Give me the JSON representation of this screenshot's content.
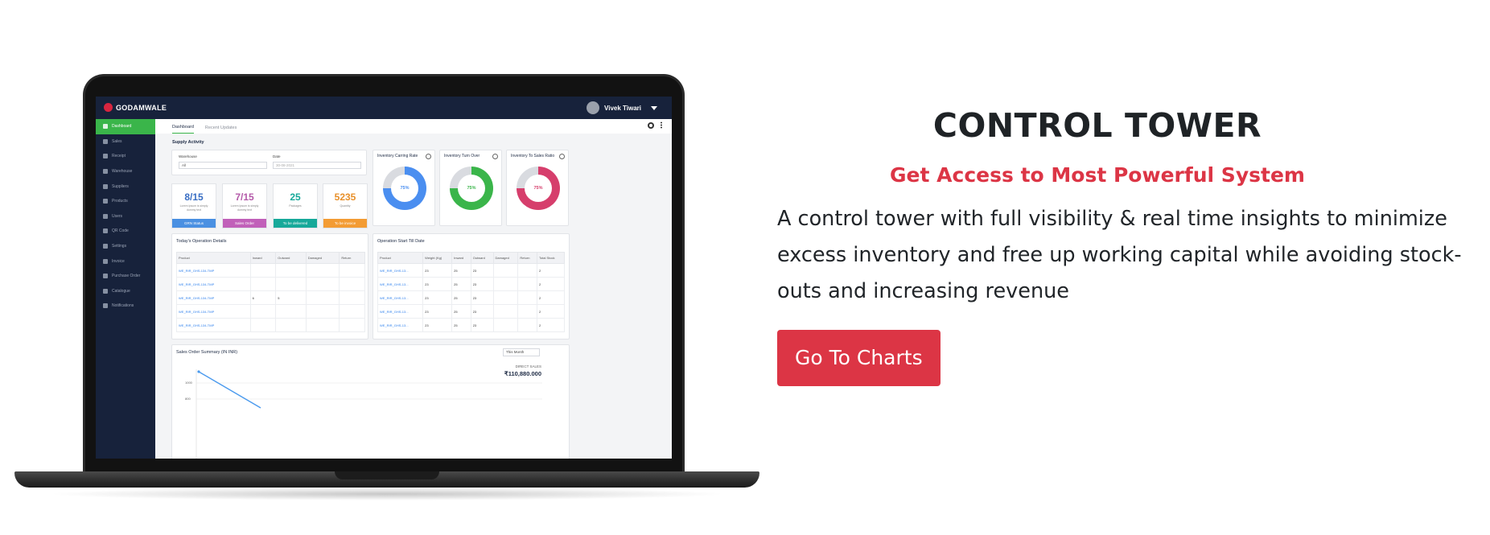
{
  "dashboard": {
    "brand": "GODAMWALE",
    "user_name": "Vivek Tiwari",
    "sidebar_items": [
      "Dashboard",
      "Sales",
      "Receipt",
      "Warehouse",
      "Suppliers",
      "Products",
      "Users",
      "QR Code",
      "Settings",
      "Invoice",
      "Purchase Order",
      "Catalogue",
      "Notifications"
    ],
    "tabs": [
      "Dashboard",
      "Recent Updates"
    ],
    "section_title": "Supply Activity",
    "filters": {
      "warehouse_label": "Warehouse",
      "warehouse_value": "All",
      "date_label": "Date",
      "date_value": "30-08-2021"
    },
    "kpis": [
      {
        "value": "8/15",
        "sub": "Lorem Ipsum is simply dummy text",
        "foot": "GRN Status",
        "color": "#4a90e2"
      },
      {
        "value": "7/15",
        "sub": "Lorem Ipsum is simply dummy text",
        "foot": "Sales Order",
        "color": "#c160b9"
      },
      {
        "value": "25",
        "sub": "Packages",
        "foot": "To be delivered",
        "color": "#17a99a"
      },
      {
        "value": "5235",
        "sub": "Quantity",
        "foot": "To be invoice",
        "color": "#f39c34"
      }
    ],
    "gauges": [
      {
        "title": "Inventory Carring Rate",
        "value": "75%",
        "fraction": 0.75,
        "color": "#4a8ef0"
      },
      {
        "title": "Inventory Turn Over",
        "value": "75%",
        "fraction": 0.75,
        "color": "#3ab54a"
      },
      {
        "title": "Inventory To Sales Ratio",
        "value": "75%",
        "fraction": 0.75,
        "color": "#d63e6c"
      }
    ],
    "todays_ops": {
      "title": "Today's Operation Details",
      "headers": [
        "Product",
        "Inward",
        "Outward",
        "Damaged",
        "Return"
      ],
      "rows": [
        [
          "WE_RIR_GHS-134-TMP",
          "",
          "",
          "",
          ""
        ],
        [
          "WE_RIR_GHS-134-TMP",
          "",
          "",
          "",
          ""
        ],
        [
          "WE_RIR_GHS-134-TMP",
          "6",
          "5",
          "",
          ""
        ],
        [
          "WE_RIR_GHS-134-TMP",
          "",
          "",
          "",
          ""
        ],
        [
          "WE_RIR_GHS-134-TMP",
          "",
          "",
          "",
          ""
        ]
      ]
    },
    "op_start": {
      "title": "Operation Start Till Date",
      "headers": [
        "Product",
        "Weight (Kg)",
        "Inward",
        "Outward",
        "Damaged",
        "Return",
        "Total Stock"
      ],
      "rows": [
        [
          "WE_RIR_GHS-13...",
          "23",
          "25",
          "23",
          "",
          "",
          "2"
        ],
        [
          "WE_RIR_GHS-13...",
          "23",
          "25",
          "23",
          "",
          "",
          "2"
        ],
        [
          "WE_RIR_GHS-13...",
          "23",
          "25",
          "23",
          "",
          "",
          "2"
        ],
        [
          "WE_RIR_GHS-13...",
          "23",
          "25",
          "23",
          "",
          "",
          "2"
        ],
        [
          "WE_RIR_GHS-13...",
          "23",
          "25",
          "23",
          "",
          "",
          "2"
        ]
      ]
    },
    "sales_summary": {
      "title": "Sales Order Summary (IN INR)",
      "period": "This Month",
      "label": "DIRECT SALES",
      "value": "₹110,880.000",
      "ticks": [
        "1000",
        "800"
      ]
    }
  },
  "content": {
    "heading": "CONTROL TOWER",
    "subheading": "Get Access to Most Powerful System",
    "description": "A control tower with full visibility & real time insights to minimize excess inventory and free up working capital while avoiding stock-outs and increasing revenue",
    "cta_label": "Go To Charts"
  }
}
